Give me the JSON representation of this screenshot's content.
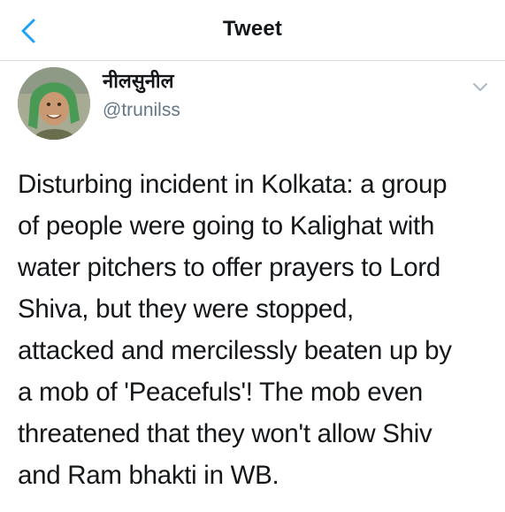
{
  "header": {
    "title": "Tweet",
    "back_icon": "chevron-left-icon"
  },
  "author": {
    "display_name": "नीलसुनील",
    "handle": "@trunilss",
    "avatar_icon": "user-avatar"
  },
  "menu": {
    "icon": "chevron-down-icon"
  },
  "tweet": {
    "lines": [
      "Disturbing incident in Kolkata: a group",
      "of people were going to Kalighat with",
      "water pitchers to offer prayers to Lord",
      "Shiva, but they were stopped,",
      "attacked and mercilessly beaten up by",
      "a mob of 'Peacefuls'! The mob even",
      "threatened that they won't allow Shiv",
      "and Ram bhakti in WB."
    ]
  },
  "colors": {
    "accent": "#1da1f2",
    "text": "#14171a",
    "secondary": "#657786",
    "divider": "#d8dde1"
  }
}
